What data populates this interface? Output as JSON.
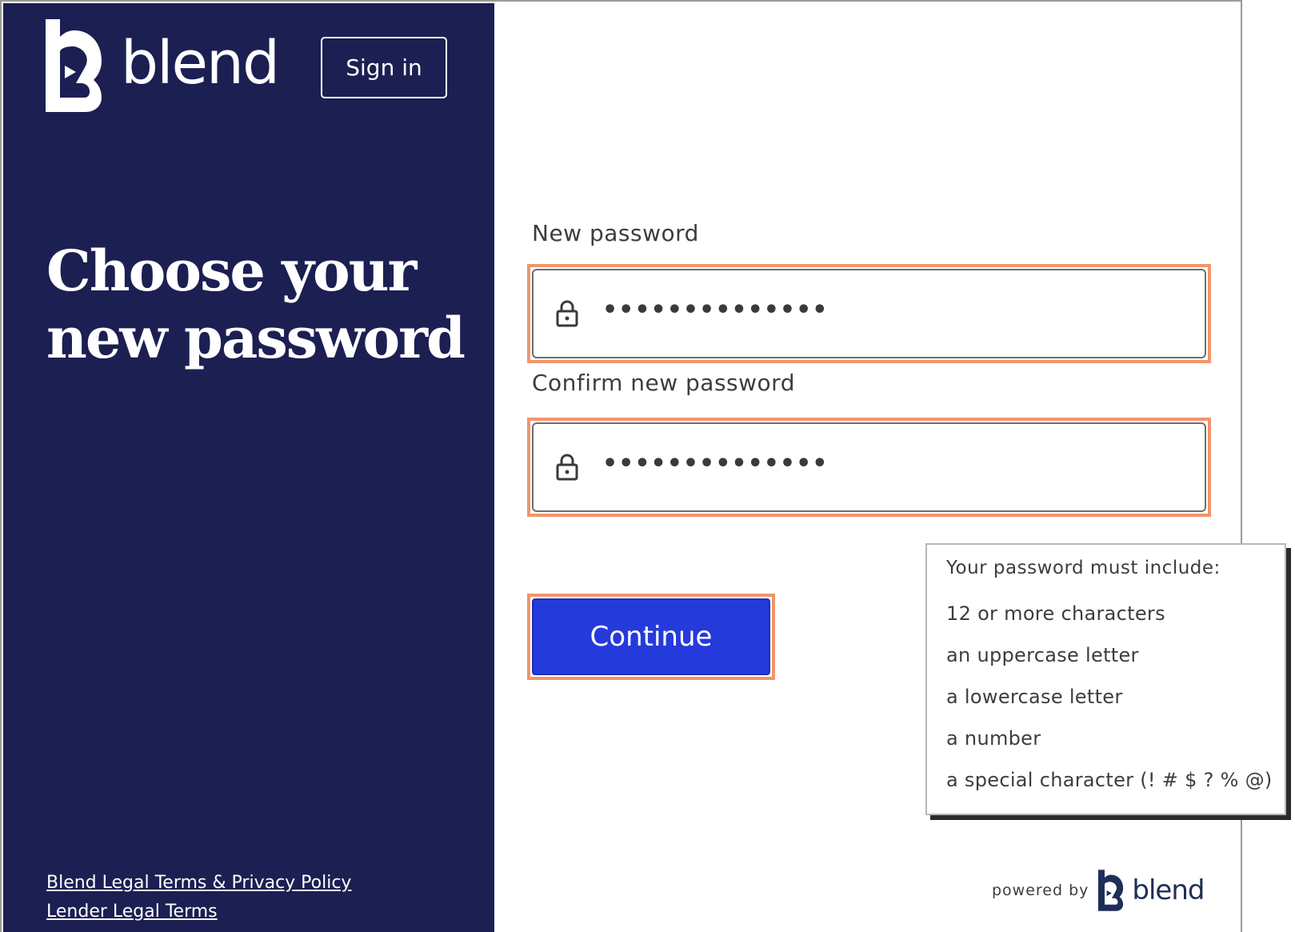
{
  "brand": {
    "name": "blend"
  },
  "header": {
    "signin_label": "Sign in"
  },
  "hero": {
    "line1": "Choose your",
    "line2": "new password"
  },
  "form": {
    "new_password": {
      "label": "New password",
      "value": "••••••••••••••"
    },
    "confirm_password": {
      "label": "Confirm new password",
      "value": "••••••••••••••"
    },
    "continue_label": "Continue"
  },
  "requirements": {
    "title": "Your password must include:",
    "items": [
      "12 or more characters",
      "an uppercase letter",
      "a lowercase letter",
      "a number",
      "a special character (! # $ ? % @)"
    ]
  },
  "footer": {
    "legal_link_1": "Blend Legal Terms & Privacy Policy",
    "legal_link_2": "Lender Legal Terms",
    "powered_by": "powered by",
    "powered_brand": "blend"
  },
  "colors": {
    "navy": "#1c1f52",
    "primary_button": "#253adb",
    "highlight_outline": "#f2956a",
    "brand_dark": "#1f2e58"
  },
  "icons": [
    "blend-logo-icon",
    "lock-icon"
  ]
}
